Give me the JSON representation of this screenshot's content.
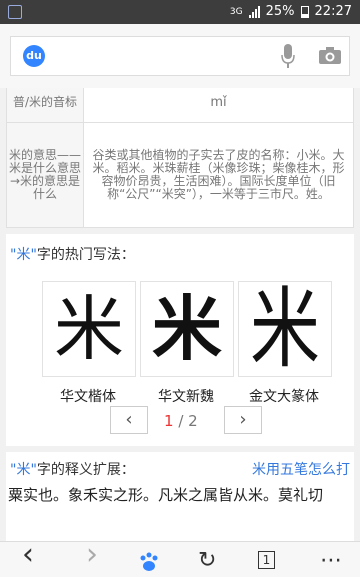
{
  "status": {
    "network": "3G",
    "battery": "25%",
    "time": "22:27"
  },
  "search": {
    "logo_text": "du",
    "placeholder": ""
  },
  "table": [
    {
      "key": "普/米的音标",
      "value": "mǐ"
    },
    {
      "key": "米的意思——米是什么意思→米的意思是什么",
      "value": "谷类或其他植物的子实去了皮的名称：小米。大米。稻米。米珠薪桂（米像珍珠；柴像桂木，形容物价昂贵，生活困难）。国际长度单位（旧称“公尺”“米突”），一米等于三市尺。姓。"
    }
  ],
  "writing": {
    "title_q": "\"米\"",
    "title_rest": "字的热门写法：",
    "cards": [
      {
        "glyph": "米",
        "label": "华文楷体"
      },
      {
        "glyph": "米",
        "label": "华文新魏"
      },
      {
        "glyph": "米",
        "label": "金文大篆体"
      }
    ],
    "pager": {
      "prev": "‹",
      "next": "›",
      "current": "1",
      "sep": " / ",
      "total": "2"
    }
  },
  "extend": {
    "title_q": "\"米\"",
    "title_rest": "字的释义扩展：",
    "link": "米用五笔怎么打",
    "text": "粟实也。象禾实之形。凡米之属皆从米。莫礼切"
  },
  "toolbar": {
    "back": "‹",
    "forward": "›",
    "refresh": "↻",
    "tabs": "1",
    "menu": "⋯"
  }
}
